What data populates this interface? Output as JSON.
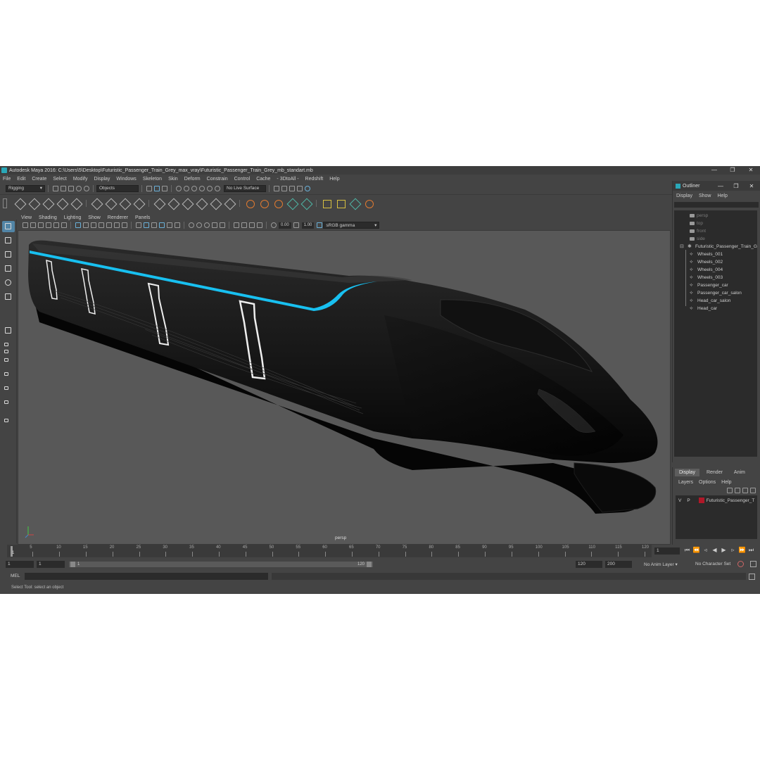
{
  "window": {
    "title": "Autodesk Maya 2016: C:\\Users\\5\\Desktop\\Futuristic_Passenger_Train_Grey_max_vray\\Futuristic_Passenger_Train_Grey_mb_standart.mb",
    "minimize": "—",
    "maximize": "❐",
    "close": "✕"
  },
  "menubar": [
    "File",
    "Edit",
    "Create",
    "Select",
    "Modify",
    "Display",
    "Windows",
    "Skeleton",
    "Skin",
    "Deform",
    "Constrain",
    "Control",
    "Cache",
    "- 3DtoAll -",
    "Redshift",
    "Help"
  ],
  "statusline": {
    "mode": "Rigging",
    "select_mode": "Objects",
    "live_surface": "No Live Surface"
  },
  "panel": {
    "menus": [
      "View",
      "Shading",
      "Lighting",
      "Show",
      "Renderer",
      "Panels"
    ],
    "exposure": "0.00",
    "gamma": "1.00",
    "color_space": "sRGB gamma",
    "camera_label": "persp"
  },
  "outliner": {
    "title": "Outliner",
    "menus": [
      "Display",
      "Show",
      "Help"
    ],
    "cameras": [
      "persp",
      "top",
      "front",
      "side"
    ],
    "group": "Futuristic_Passenger_Train_G",
    "children": [
      "Wheels_001",
      "Wheels_002",
      "Wheels_004",
      "Wheels_003",
      "Passenger_car",
      "Passenger_car_salon",
      "Head_car_salon",
      "Head_car"
    ]
  },
  "layers": {
    "tabs": [
      "Display",
      "Render",
      "Anim"
    ],
    "menus": [
      "Layers",
      "Options",
      "Help"
    ],
    "layer": {
      "v": "V",
      "p": "P",
      "name": "Futuristic_Passenger_T",
      "color": "#b01828"
    }
  },
  "timeline": {
    "labels": [
      "5",
      "10",
      "15",
      "20",
      "25",
      "30",
      "35",
      "40",
      "45",
      "50",
      "55",
      "60",
      "65",
      "70",
      "75",
      "80",
      "85",
      "90",
      "95",
      "100",
      "105",
      "110",
      "115",
      "120"
    ],
    "current_frame": "1",
    "playhead_label": "1"
  },
  "range": {
    "start": "1",
    "anim_start": "1",
    "slider_start": "1",
    "slider_end": "120",
    "playback_end": "120",
    "anim_end": "200",
    "anim_layer": "No Anim Layer",
    "character_set": "No Character Set"
  },
  "cmd": {
    "label": "MEL"
  },
  "help": {
    "text": "Select Tool: select an object"
  },
  "colors": {
    "accent": "#5285a6",
    "train_stripe": "#18c0f0"
  }
}
